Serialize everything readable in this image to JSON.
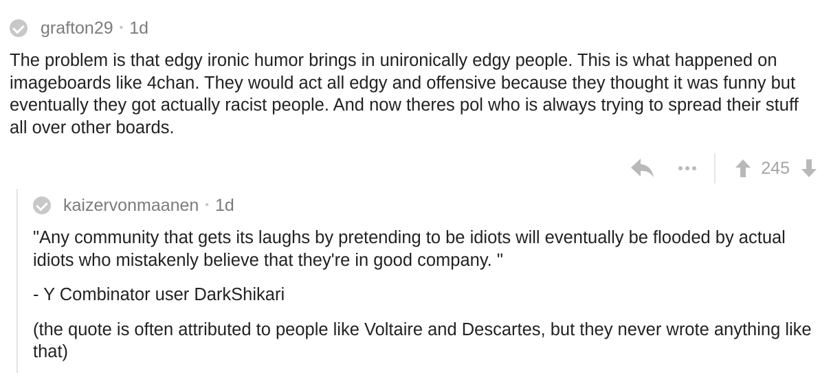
{
  "comment": {
    "author": "grafton29",
    "separator": "•",
    "age": "1d",
    "text": "The problem is that edgy ironic humor brings in unironically edgy people. This is what happened on imageboards like 4chan. They would act all edgy and offensive because they thought it was funny but eventually they got actually racist people. And now theres pol who is always trying to spread their stuff all over other boards.",
    "score": "245",
    "verified_icon": "check-circle-icon",
    "reply_icon": "reply-arrow-icon",
    "more_icon": "more-dots-icon",
    "upvote_icon": "upvote-arrow-icon",
    "downvote_icon": "downvote-arrow-icon"
  },
  "reply": {
    "author": "kaizervonmaanen",
    "separator": "•",
    "age": "1d",
    "paragraphs": [
      "\"Any community that gets its laughs by pretending to be idiots will eventually be flooded by actual idiots who mistakenly believe that they're in good company. \"",
      "- Y Combinator user DarkShikari",
      "(the quote is often attributed to people like Voltaire and Descartes, but they never wrote anything like that)"
    ]
  },
  "colors": {
    "meta_text": "#7c7c7c",
    "icon_grey": "#c8c8c8",
    "score_text": "#a4a4a4",
    "body_text": "#222222"
  }
}
